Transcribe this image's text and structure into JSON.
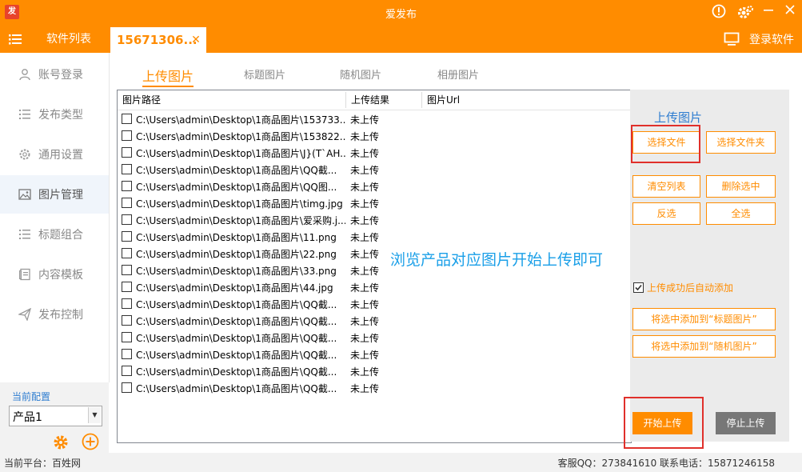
{
  "app": {
    "title": "爱发布",
    "logo_text": "发"
  },
  "tabs": {
    "software_list": "软件列表",
    "active_tab": "15671306...",
    "login": "登录软件"
  },
  "sidebar": {
    "items": [
      {
        "label": "账号登录",
        "icon": "user-icon"
      },
      {
        "label": "发布类型",
        "icon": "list-icon"
      },
      {
        "label": "通用设置",
        "icon": "gear-icon"
      },
      {
        "label": "图片管理",
        "icon": "image-icon",
        "active": true
      },
      {
        "label": "标题组合",
        "icon": "list-icon"
      },
      {
        "label": "内容模板",
        "icon": "document-icon"
      },
      {
        "label": "发布控制",
        "icon": "send-icon"
      }
    ],
    "config_label": "当前配置",
    "config_value": "产品1"
  },
  "subtabs": [
    "上传图片",
    "标题图片",
    "随机图片",
    "相册图片"
  ],
  "table": {
    "headers": [
      "图片路径",
      "上传结果",
      "图片Url"
    ],
    "rows": [
      {
        "path": "C:\\Users\\admin\\Desktop\\1商品图片\\153733...",
        "result": "未上传"
      },
      {
        "path": "C:\\Users\\admin\\Desktop\\1商品图片\\153822...",
        "result": "未上传"
      },
      {
        "path": "C:\\Users\\admin\\Desktop\\1商品图片\\J}(T`AH...",
        "result": "未上传"
      },
      {
        "path": "C:\\Users\\admin\\Desktop\\1商品图片\\QQ截...",
        "result": "未上传"
      },
      {
        "path": "C:\\Users\\admin\\Desktop\\1商品图片\\QQ图...",
        "result": "未上传"
      },
      {
        "path": "C:\\Users\\admin\\Desktop\\1商品图片\\timg.jpg",
        "result": "未上传"
      },
      {
        "path": "C:\\Users\\admin\\Desktop\\1商品图片\\爱采购.j...",
        "result": "未上传"
      },
      {
        "path": "C:\\Users\\admin\\Desktop\\1商品图片\\11.png",
        "result": "未上传"
      },
      {
        "path": "C:\\Users\\admin\\Desktop\\1商品图片\\22.png",
        "result": "未上传"
      },
      {
        "path": "C:\\Users\\admin\\Desktop\\1商品图片\\33.png",
        "result": "未上传"
      },
      {
        "path": "C:\\Users\\admin\\Desktop\\1商品图片\\44.jpg",
        "result": "未上传"
      },
      {
        "path": "C:\\Users\\admin\\Desktop\\1商品图片\\QQ截...",
        "result": "未上传"
      },
      {
        "path": "C:\\Users\\admin\\Desktop\\1商品图片\\QQ截...",
        "result": "未上传"
      },
      {
        "path": "C:\\Users\\admin\\Desktop\\1商品图片\\QQ截...",
        "result": "未上传"
      },
      {
        "path": "C:\\Users\\admin\\Desktop\\1商品图片\\QQ截...",
        "result": "未上传"
      },
      {
        "path": "C:\\Users\\admin\\Desktop\\1商品图片\\QQ截...",
        "result": "未上传"
      },
      {
        "path": "C:\\Users\\admin\\Desktop\\1商品图片\\QQ截...",
        "result": "未上传"
      }
    ]
  },
  "overlay_tip": "浏览产品对应图片开始上传即可",
  "right_panel": {
    "title": "上传图片",
    "select_files": "选择文件",
    "select_folder": "选择文件夹",
    "clear_list": "清空列表",
    "delete_selected": "删除选中",
    "invert": "反选",
    "select_all": "全选",
    "auto_add": "上传成功后自动添加",
    "add_to_title": "将选中添加到“标题图片”",
    "add_to_random": "将选中添加到“随机图片”",
    "start_upload": "开始上传",
    "stop_upload": "停止上传"
  },
  "status": {
    "platform": "当前平台：百姓网",
    "contact": "客服QQ：273841610    联系电话：15871246158"
  },
  "colors": {
    "brand": "#ff8c00",
    "highlight": "#e0302b",
    "info": "#1a9fe8",
    "link": "#2d7cd0"
  }
}
